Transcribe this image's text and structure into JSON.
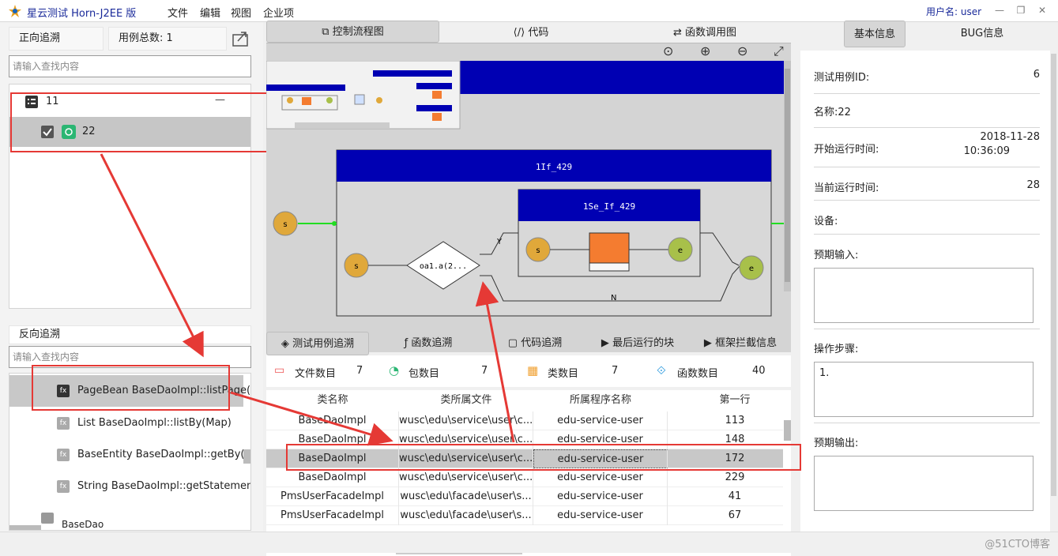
{
  "window": {
    "title": "星云测试 Horn-J2EE 版",
    "menu": [
      "文件",
      "编辑",
      "视图",
      "企业项"
    ],
    "user_label": "用户名: user"
  },
  "left": {
    "forward_tab": "正向追溯",
    "case_total_label": "用例总数: 1",
    "forward_search_placeholder": "请输入查找内容",
    "tree": [
      {
        "label": "11"
      },
      {
        "label": "22"
      }
    ],
    "backward_tab": "反向追溯",
    "backward_search_placeholder": "请输入查找内容",
    "functions": [
      {
        "label": "PageBean BaseDaoImpl::listPage(Pa"
      },
      {
        "label": "List BaseDaoImpl::listBy(Map)"
      },
      {
        "label": "BaseEntity BaseDaoImpl::getBy(Ma"
      },
      {
        "label": "String BaseDaoImpl::getStatement"
      },
      {
        "label": "BaseDao"
      }
    ]
  },
  "center": {
    "tabs": [
      "控制流程图",
      "代码",
      "函数调用图"
    ],
    "graph": {
      "if_block": "1If_429",
      "inner_block": "1Se_If_429",
      "condition": "oa1.a(2...",
      "start": "s",
      "end": "e",
      "branch_yes": "Y",
      "branch_no": "N"
    },
    "bottom_tabs": [
      "测试用例追溯",
      "函数追溯",
      "代码追溯",
      "最后运行的块",
      "框架拦截信息"
    ],
    "stats": [
      {
        "label": "文件数目",
        "value": "7"
      },
      {
        "label": "包数目",
        "value": "7"
      },
      {
        "label": "类数目",
        "value": "7"
      },
      {
        "label": "函数数目",
        "value": "40"
      }
    ],
    "columns": [
      "类名称",
      "类所属文件",
      "所属程序名称",
      "第一行"
    ],
    "rows": [
      [
        "BaseDaoImpl",
        "wusc\\edu\\service\\user\\c...",
        "edu-service-user",
        "113"
      ],
      [
        "BaseDaoImpl",
        "wusc\\edu\\service\\user\\c...",
        "edu-service-user",
        "148"
      ],
      [
        "BaseDaoImpl",
        "wusc\\edu\\service\\user\\c...",
        "edu-service-user",
        "172"
      ],
      [
        "BaseDaoImpl",
        "wusc\\edu\\service\\user\\c...",
        "edu-service-user",
        "229"
      ],
      [
        "PmsUserFacadeImpl",
        "wusc\\edu\\facade\\user\\s...",
        "edu-service-user",
        "41"
      ],
      [
        "PmsUserFacadeImpl",
        "wusc\\edu\\facade\\user\\s...",
        "edu-service-user",
        "67"
      ]
    ]
  },
  "right": {
    "tabs": [
      "基本信息",
      "BUG信息"
    ],
    "case_id_label": "测试用例ID:",
    "case_id": "6",
    "name_label": "名称:22",
    "start_time_label": "开始运行时间:",
    "start_date": "2018-11-28",
    "start_clock": "10:36:09",
    "current_time_label": "当前运行时间:",
    "current_time": "28",
    "device_label": "设备:",
    "expected_input_label": "预期输入:",
    "steps_label": "操作步骤:",
    "steps_value": "1.",
    "expected_output_label": "预期输出:"
  },
  "watermark": "@51CTO博客",
  "colors": {
    "accent_blue": "#0000b3",
    "highlight_red": "#e53935",
    "node_orange": "#e0a83a",
    "node_green": "#a8c04a",
    "block_orange": "#f47c30"
  }
}
